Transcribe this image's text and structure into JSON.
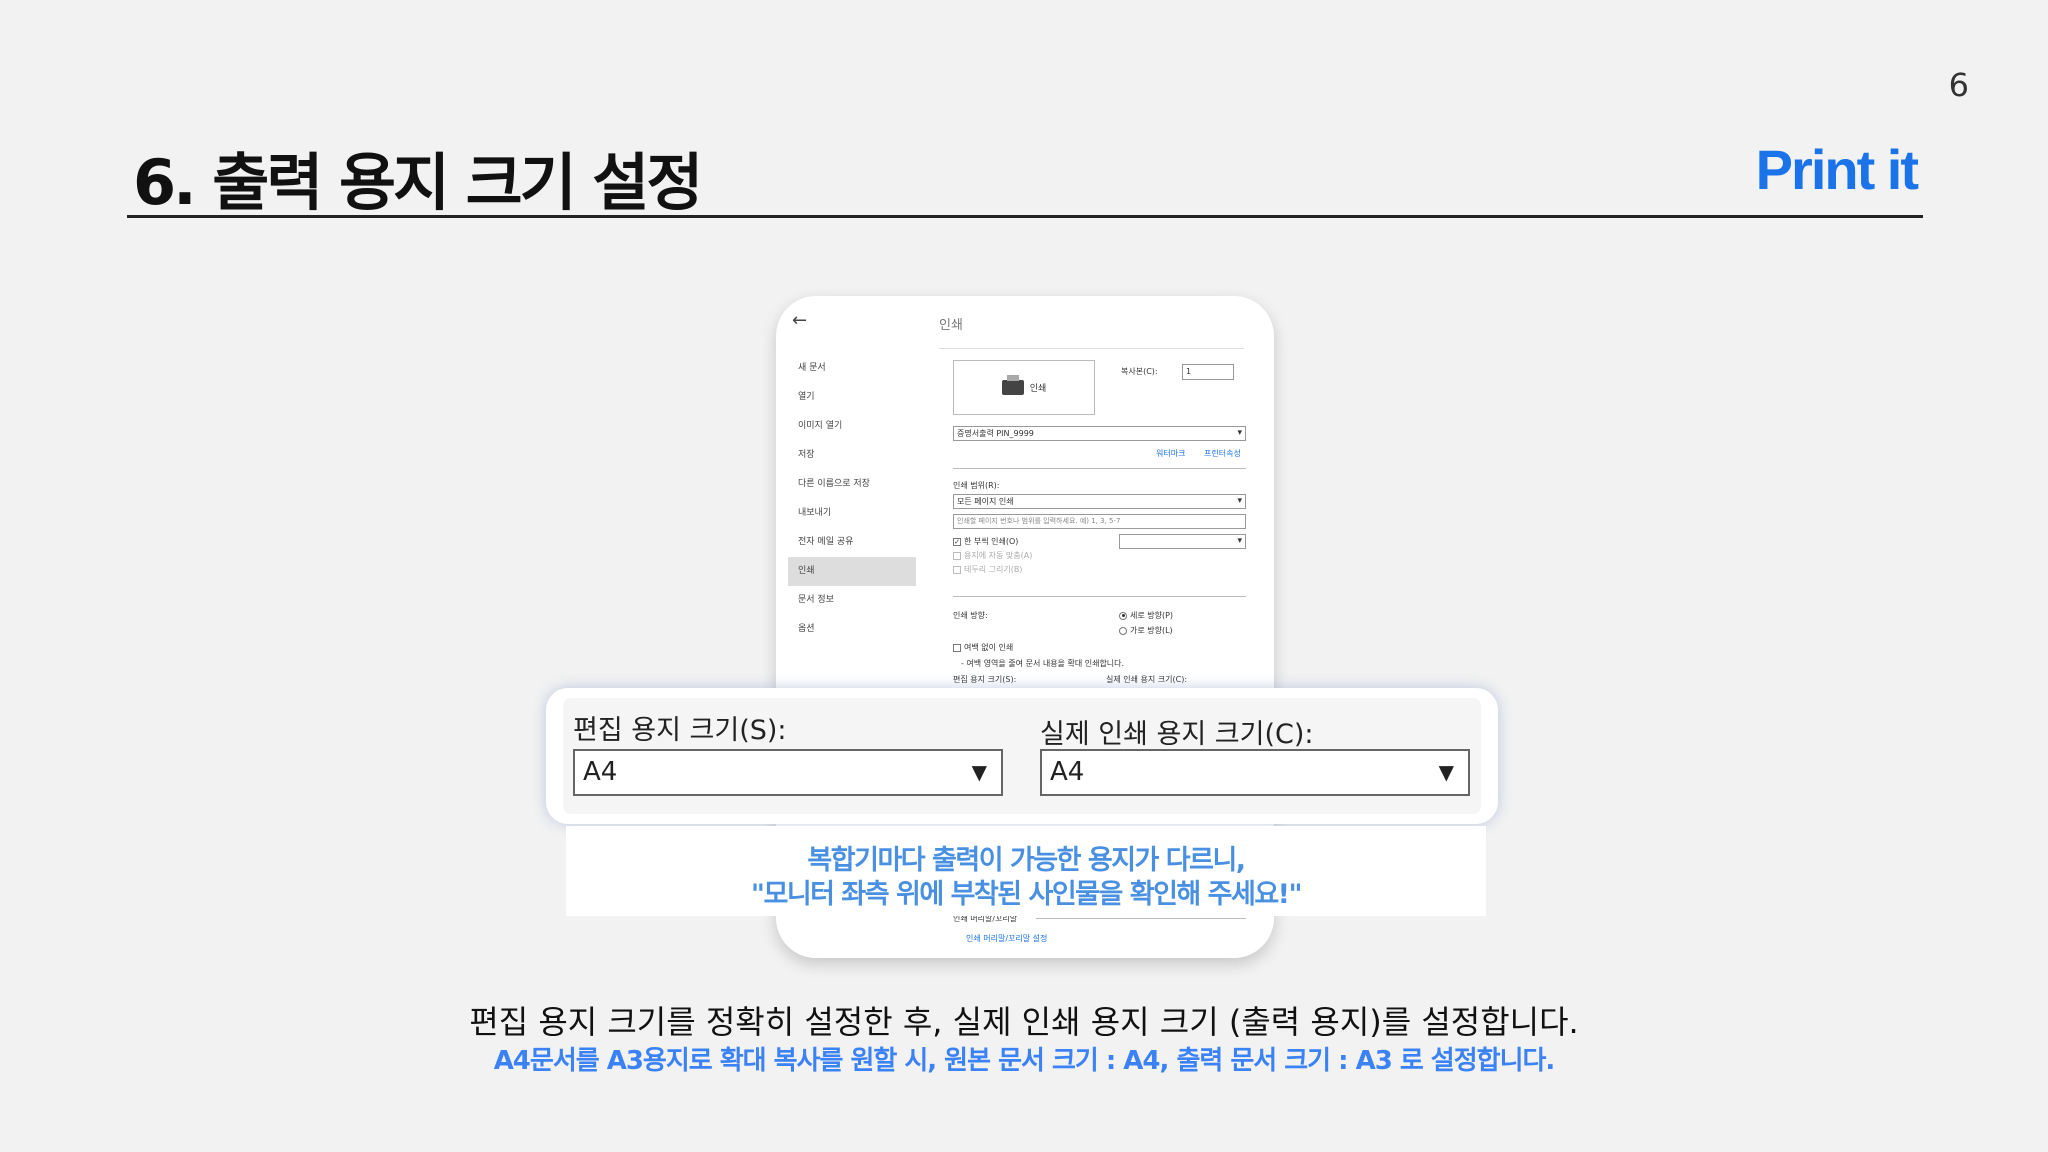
{
  "page_number": "6",
  "title": "6. 출력 용지 크기 설정",
  "brand": "Print it",
  "dialog": {
    "back_icon": "arrow-left-icon",
    "panel_title": "인쇄",
    "nav_items": [
      "새 문서",
      "열기",
      "이미지 열기",
      "저장",
      "다른 이름으로 저장",
      "내보내기",
      "전자 메일 공유",
      "인쇄",
      "문서 정보",
      "옵션"
    ],
    "active_nav": "인쇄",
    "print_button": "인쇄",
    "copies_label": "복사본(C):",
    "copies_value": "1",
    "printer_name": "증명서출력 PIN_9999",
    "link_watermark": "워터마크",
    "link_properties": "프린터속성",
    "range_label": "인쇄 범위(R):",
    "range_value": "모든 페이지 인쇄",
    "pages_placeholder": "인쇄할 페이지 번호나 범위를 입력하세요. 예) 1, 3, 5-7",
    "collate_label": "한 부씩 인쇄(O)",
    "fit_label": "용지에 자동 맞춤(A)",
    "border_label": "테두리 그리기(B)",
    "orientation_label": "인쇄 방향:",
    "portrait": "세로 방향(P)",
    "landscape": "가로 방향(L)",
    "borderless": "여백 없이 인쇄",
    "borderless_note": "- 여백 영역을 줄여 문서 내용을 확대 인쇄합니다.",
    "edit_size_small": "편집 용지 크기(S):",
    "actual_size_small": "실제 인쇄 용지 크기(C):",
    "header_footer_label": "인쇄 머리말/꼬리말",
    "header_footer_link": "인쇄 머리말/꼬리말 설정"
  },
  "zoom": {
    "edit_label": "편집 용지 크기(S):",
    "edit_value": "A4",
    "actual_label": "실제 인쇄 용지 크기(C):",
    "actual_value": "A4"
  },
  "notice": {
    "line1": "복합기마다 출력이 가능한 용지가 다르니,",
    "line2": "\"모니터 좌측 위에 부착된 사인물을 확인해 주세요!\""
  },
  "caption": {
    "line1": "편집 용지 크기를 정확히 설정한 후, 실제 인쇄 용지 크기 (출력 용지)를 설정합니다.",
    "line2": "A4문서를 A3용지로 확대 복사를 원할 시, 원본 문서 크기 : A4, 출력 문서 크기 : A3 로 설정합니다."
  },
  "colors": {
    "accent": "#1a73e8",
    "notice": "#4a90e2",
    "caption_blue": "#3b82f6"
  }
}
